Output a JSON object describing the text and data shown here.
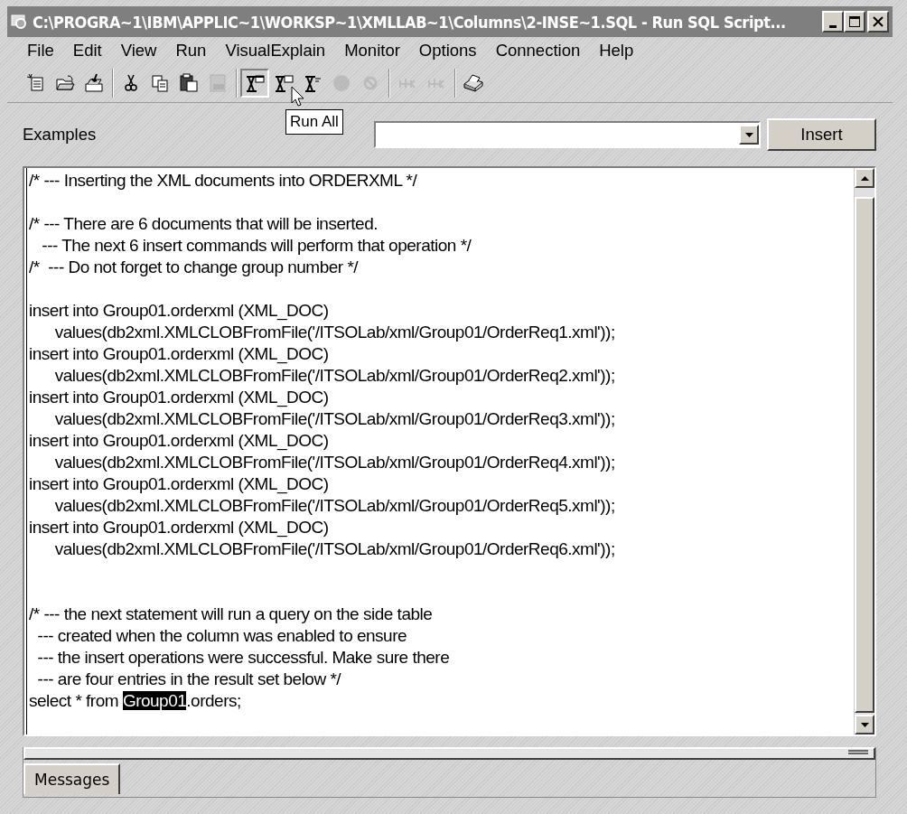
{
  "window": {
    "title": "C:\\PROGRA~1\\IBM\\APPLIC~1\\WORKSP~1\\XMLLAB~1\\Columns\\2-INSE~1.SQL - Run SQL Script..."
  },
  "menu": [
    "File",
    "Edit",
    "View",
    "Run",
    "VisualExplain",
    "Monitor",
    "Options",
    "Connection",
    "Help"
  ],
  "toolbar": {
    "groups": [
      [
        {
          "disabled": false,
          "pressed": false
        },
        {
          "disabled": false,
          "pressed": false
        },
        {
          "disabled": false,
          "pressed": false
        }
      ],
      [
        {
          "disabled": false,
          "pressed": false
        },
        {
          "disabled": false,
          "pressed": false
        },
        {
          "disabled": false,
          "pressed": false
        },
        {
          "disabled": true,
          "pressed": false
        }
      ],
      [
        {
          "disabled": false,
          "pressed": true
        },
        {
          "disabled": false,
          "pressed": false
        },
        {
          "disabled": false,
          "pressed": false
        },
        {
          "disabled": true,
          "pressed": false
        },
        {
          "disabled": true,
          "pressed": false
        }
      ],
      [
        {
          "disabled": true,
          "pressed": false
        },
        {
          "disabled": true,
          "pressed": false
        }
      ],
      [
        {
          "disabled": false,
          "pressed": false
        }
      ]
    ],
    "tooltip": "Run All"
  },
  "examples": {
    "label": "Examples",
    "button": "Insert"
  },
  "editor": {
    "lines": [
      {
        "kind": "code",
        "segments": [
          {
            "text": "/* --- Inserting the XML documents into ORDERXML */",
            "selected": false
          }
        ]
      },
      {
        "kind": "blank"
      },
      {
        "kind": "code",
        "segments": [
          {
            "text": "/* --- There are 6 documents that will be inserted.",
            "selected": false
          }
        ]
      },
      {
        "kind": "code",
        "segments": [
          {
            "text": "   --- The next 6 insert commands will perform that operation */",
            "selected": false
          }
        ]
      },
      {
        "kind": "code",
        "segments": [
          {
            "text": "/*  --- Do not forget to change group number */",
            "selected": false
          }
        ]
      },
      {
        "kind": "blank"
      },
      {
        "kind": "code",
        "segments": [
          {
            "text": "insert into Group01.orderxml (XML_DOC)",
            "selected": false
          }
        ]
      },
      {
        "kind": "code",
        "segments": [
          {
            "text": "      values(db2xml.XMLCLOBFromFile('/ITSOLab/xml/Group01/OrderReq1.xml'));",
            "selected": false
          }
        ]
      },
      {
        "kind": "code",
        "segments": [
          {
            "text": "insert into Group01.orderxml (XML_DOC)",
            "selected": false
          }
        ]
      },
      {
        "kind": "code",
        "segments": [
          {
            "text": "      values(db2xml.XMLCLOBFromFile('/ITSOLab/xml/Group01/OrderReq2.xml'));",
            "selected": false
          }
        ]
      },
      {
        "kind": "code",
        "segments": [
          {
            "text": "insert into Group01.orderxml (XML_DOC)",
            "selected": false
          }
        ]
      },
      {
        "kind": "code",
        "segments": [
          {
            "text": "      values(db2xml.XMLCLOBFromFile('/ITSOLab/xml/Group01/OrderReq3.xml'));",
            "selected": false
          }
        ]
      },
      {
        "kind": "code",
        "segments": [
          {
            "text": "insert into Group01.orderxml (XML_DOC)",
            "selected": false
          }
        ]
      },
      {
        "kind": "code",
        "segments": [
          {
            "text": "      values(db2xml.XMLCLOBFromFile('/ITSOLab/xml/Group01/OrderReq4.xml'));",
            "selected": false
          }
        ]
      },
      {
        "kind": "code",
        "segments": [
          {
            "text": "insert into Group01.orderxml (XML_DOC)",
            "selected": false
          }
        ]
      },
      {
        "kind": "code",
        "segments": [
          {
            "text": "      values(db2xml.XMLCLOBFromFile('/ITSOLab/xml/Group01/OrderReq5.xml'));",
            "selected": false
          }
        ]
      },
      {
        "kind": "code",
        "segments": [
          {
            "text": "insert into Group01.orderxml (XML_DOC)",
            "selected": false
          }
        ]
      },
      {
        "kind": "code",
        "segments": [
          {
            "text": "      values(db2xml.XMLCLOBFromFile('/ITSOLab/xml/Group01/OrderReq6.xml'));",
            "selected": false
          }
        ]
      },
      {
        "kind": "blank"
      },
      {
        "kind": "blank"
      },
      {
        "kind": "code",
        "segments": [
          {
            "text": "/* --- the next statement will run a query on the side table",
            "selected": false
          }
        ]
      },
      {
        "kind": "code",
        "segments": [
          {
            "text": "  --- created when the column was enabled to ensure",
            "selected": false
          }
        ]
      },
      {
        "kind": "code",
        "segments": [
          {
            "text": "  --- the insert operations were successful. Make sure there",
            "selected": false
          }
        ]
      },
      {
        "kind": "code",
        "segments": [
          {
            "text": "  --- are four entries in the result set below */",
            "selected": false
          }
        ]
      },
      {
        "kind": "code",
        "segments": [
          {
            "text": "select * from ",
            "selected": false
          },
          {
            "text": "Group01",
            "selected": true
          },
          {
            "text": ".orders;",
            "selected": false
          }
        ]
      }
    ]
  },
  "messages": {
    "tab": "Messages"
  }
}
